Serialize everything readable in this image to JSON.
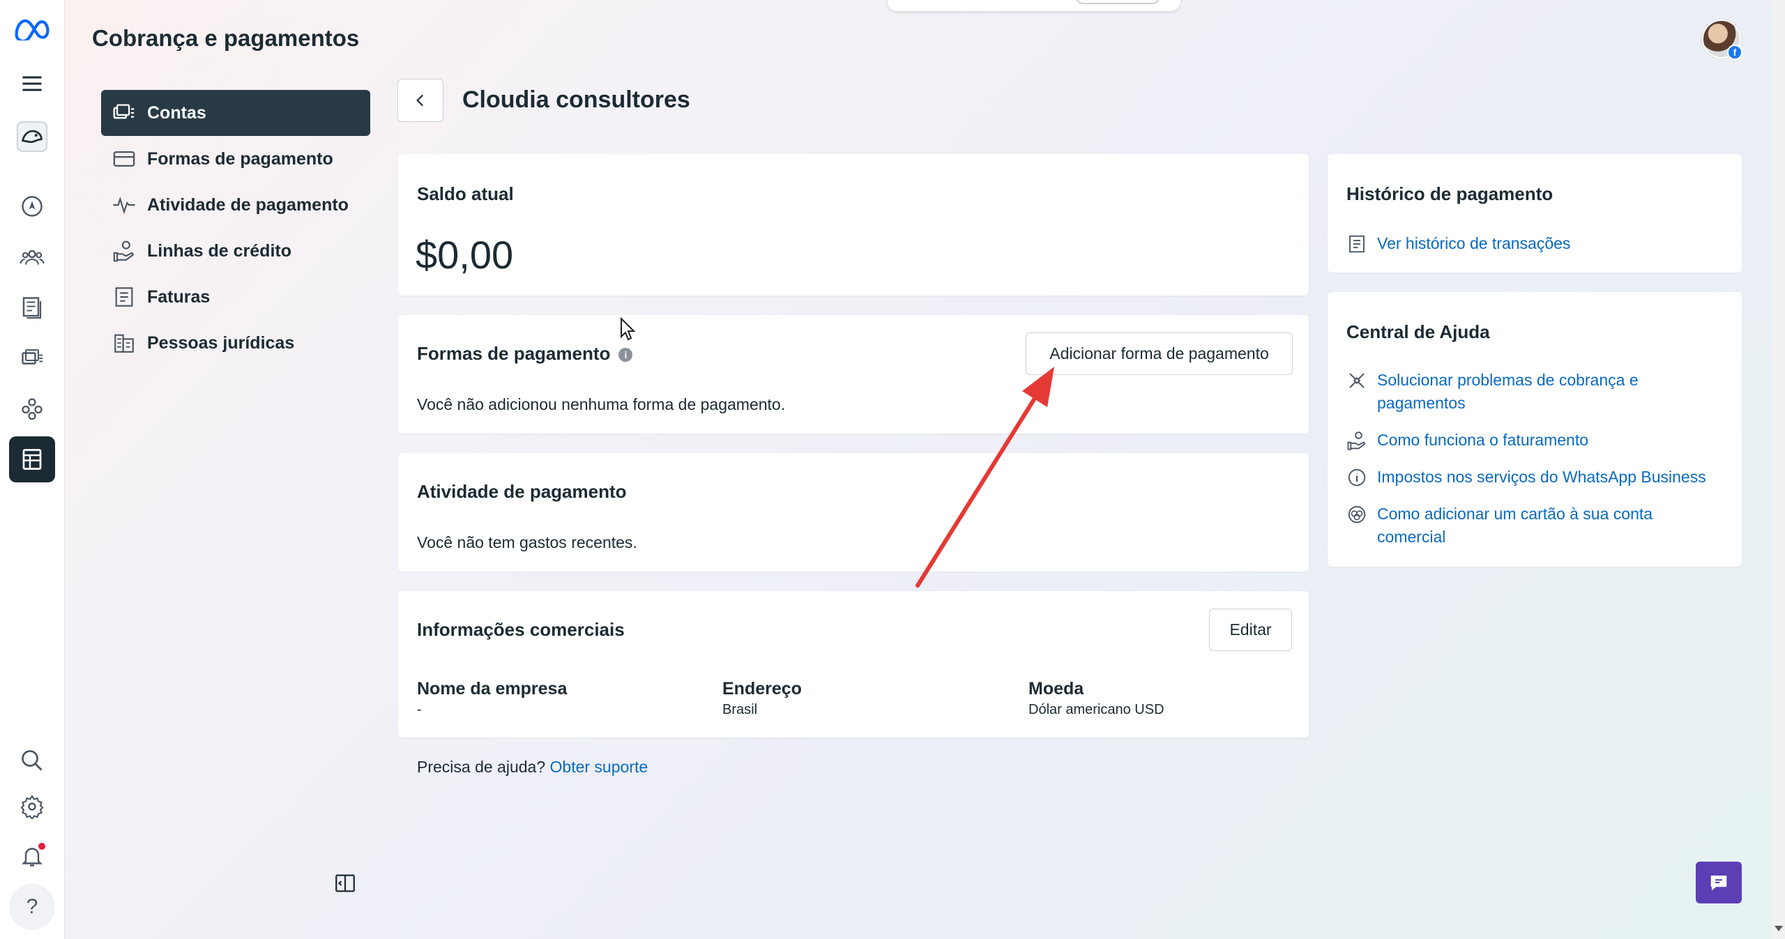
{
  "header": {
    "title": "Cobrança e pagamentos"
  },
  "rail": {
    "icons": [
      "meta-logo-icon",
      "menu-icon",
      "brand-avatar-icon",
      "compass-icon",
      "people-icon",
      "pages-icon",
      "accounts-icon",
      "integrations-icon",
      "billing-icon",
      "search-icon",
      "settings-icon",
      "notifications-icon",
      "help-icon"
    ]
  },
  "subnav": {
    "items": [
      {
        "label": "Contas",
        "icon": "accounts-icon",
        "active": true
      },
      {
        "label": "Formas de pagamento",
        "icon": "card-icon"
      },
      {
        "label": "Atividade de pagamento",
        "icon": "activity-icon"
      },
      {
        "label": "Linhas de crédito",
        "icon": "credit-line-icon"
      },
      {
        "label": "Faturas",
        "icon": "invoice-icon"
      },
      {
        "label": "Pessoas jurídicas",
        "icon": "building-icon"
      }
    ]
  },
  "main": {
    "account_name": "Cloudia consultores",
    "balance": {
      "title": "Saldo atual",
      "amount": "$0,00"
    },
    "payment_methods": {
      "title": "Formas de pagamento",
      "add_button": "Adicionar forma de pagamento",
      "empty_text": "Você não adicionou nenhuma forma de pagamento."
    },
    "payment_activity": {
      "title": "Atividade de pagamento",
      "empty_text": "Você não tem gastos recentes."
    },
    "business_info": {
      "title": "Informações comerciais",
      "edit_button": "Editar",
      "fields": [
        {
          "label": "Nome da empresa",
          "value": "-"
        },
        {
          "label": "Endereço",
          "value": "Brasil"
        },
        {
          "label": "Moeda",
          "value": "Dólar americano USD"
        }
      ]
    },
    "support": {
      "question": "Precisa de ajuda?",
      "link": "Obter suporte"
    }
  },
  "side": {
    "history": {
      "title": "Histórico de pagamento",
      "link": "Ver histórico de transações"
    },
    "help_center": {
      "title": "Central de Ajuda",
      "links": [
        {
          "label": "Solucionar problemas de cobrança e pagamentos",
          "icon": "tools-icon"
        },
        {
          "label": "Como funciona o faturamento",
          "icon": "billing-hand-icon"
        },
        {
          "label": "Impostos nos serviços do WhatsApp Business",
          "icon": "info-circle-icon"
        },
        {
          "label": "Como adicionar um cartão à sua conta comercial",
          "icon": "card-circle-icon"
        }
      ]
    }
  },
  "colors": {
    "sidebar_active": "#273a45",
    "link": "#0a6ac0",
    "annotation_arrow": "#e53935",
    "chat_button": "#5b3fb5"
  }
}
